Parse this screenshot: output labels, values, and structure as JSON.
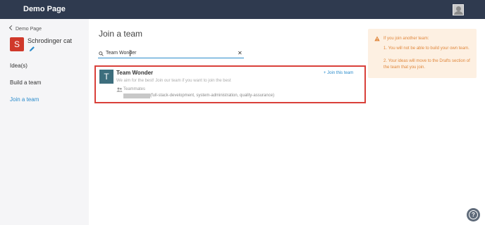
{
  "app": {
    "title": "Demo Page"
  },
  "sidebar": {
    "back_label": "Demo Page",
    "user": {
      "initial": "S",
      "name": "Schrodinger cat"
    },
    "nav": [
      {
        "label": "Idea(s)",
        "active": false
      },
      {
        "label": "Build a team",
        "active": false
      },
      {
        "label": "Join a team",
        "active": true
      }
    ]
  },
  "main": {
    "title": "Join a team",
    "search": {
      "value": "Team Wonder"
    },
    "result": {
      "initial": "T",
      "name": "Team Wonder",
      "description": "We aim for the best! Join our team if you want to join the best",
      "teammates_label": "Teammates",
      "teammates_roles": "(full-stack-development, system-administration, quality-assurance)",
      "join_label": "+ Join this team"
    }
  },
  "warning": {
    "title": "If you join another team:",
    "items": [
      "1. You will not be able to build your own team.",
      "2. Your ideas will move to the Drafts section of the team that you join."
    ]
  },
  "help": {
    "symbol": "?"
  },
  "colors": {
    "header_bg": "#2f3a4f",
    "accent": "#2b8ccc",
    "highlight_border": "#d9403a",
    "warning_text": "#e0873c",
    "warning_bg": "#fdf0e2",
    "user_avatar": "#d0392b",
    "team_avatar": "#3d6e7d"
  },
  "icons": [
    "user-avatar-icon",
    "chevron-left-icon",
    "pencil-icon",
    "search-icon",
    "close-icon",
    "people-icon",
    "warning-icon",
    "help-icon"
  ]
}
